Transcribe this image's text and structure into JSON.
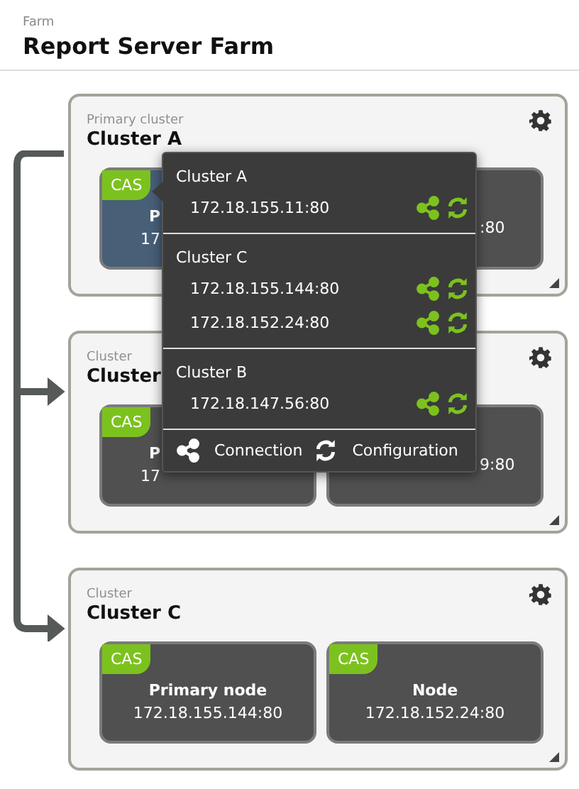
{
  "header": {
    "label": "Farm",
    "title": "Report Server Farm"
  },
  "clusters": [
    {
      "label": "Primary cluster",
      "name": "Cluster A",
      "nodes": [
        {
          "badge": "CAS",
          "title": "P",
          "address": "17",
          "selected": true,
          "covered": true
        },
        {
          "address": ":80",
          "selected": false,
          "covered": true
        }
      ]
    },
    {
      "label": "Cluster",
      "name": "Cluster",
      "nodes": [
        {
          "badge": "CAS",
          "title": "P",
          "address": "17",
          "selected": false,
          "covered": true
        },
        {
          "address": "9:80",
          "selected": false,
          "covered": true
        }
      ]
    },
    {
      "label": "Cluster",
      "name": "Cluster C",
      "nodes": [
        {
          "badge": "CAS",
          "title": "Primary node",
          "address": "172.18.155.144:80",
          "selected": false,
          "covered": false
        },
        {
          "badge": "CAS",
          "title": "Node",
          "address": "172.18.152.24:80",
          "selected": false,
          "covered": false
        }
      ]
    }
  ],
  "popup": {
    "sections": [
      {
        "title": "Cluster A",
        "addresses": [
          "172.18.155.11:80"
        ]
      },
      {
        "title": "Cluster C",
        "addresses": [
          "172.18.155.144:80",
          "172.18.152.24:80"
        ]
      },
      {
        "title": "Cluster B",
        "addresses": [
          "172.18.147.56:80"
        ]
      }
    ],
    "legend": [
      "Connection",
      "Configuration"
    ]
  }
}
